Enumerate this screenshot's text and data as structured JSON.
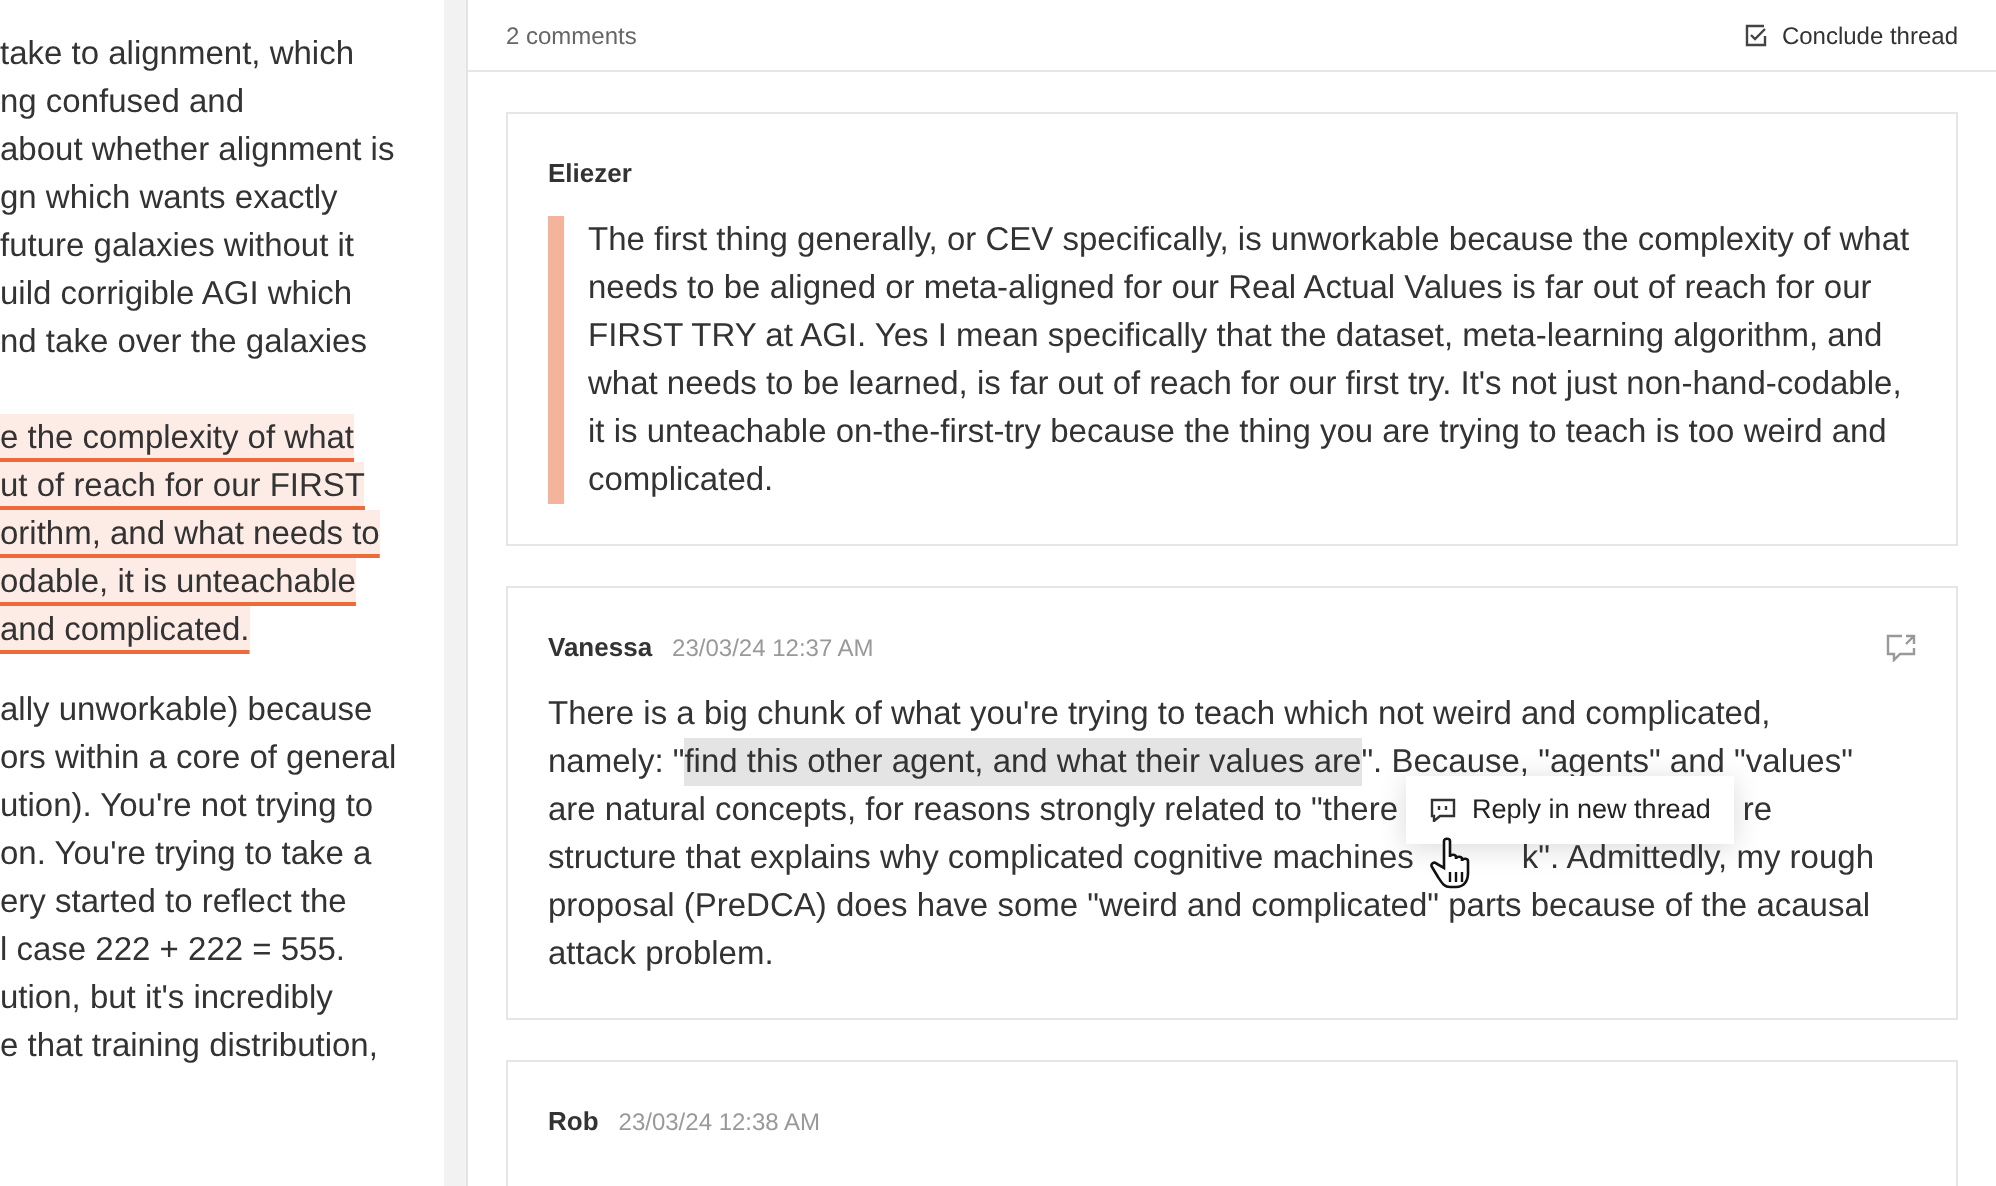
{
  "document": {
    "paragraphs": [
      {
        "highlighted": false,
        "lines": [
          "take to alignment, which",
          "ng confused and",
          "about whether alignment is",
          "gn which wants exactly",
          "future galaxies without it",
          "uild corrigible AGI which",
          "nd take over the galaxies"
        ]
      },
      {
        "highlighted": true,
        "lines": [
          "e the complexity of what",
          "ut of reach for our FIRST",
          "orithm, and what needs to",
          "odable, it is unteachable",
          "and complicated."
        ]
      },
      {
        "highlighted": false,
        "lines": [
          "ally unworkable) because",
          "ors within a core of general",
          "ution). You're not trying to",
          "on. You're trying to take a",
          "ery started to reflect the",
          "l case 222 + 222 = 555.",
          "ution, but it's incredibly",
          "e that training distribution,"
        ]
      }
    ]
  },
  "thread": {
    "count": "2 comments",
    "conclude_label": "Conclude thread"
  },
  "comments": [
    {
      "author": "Eliezer",
      "kind": "quote",
      "text": "The first thing generally, or CEV specifically, is unworkable because the complexity of what needs to be aligned or meta-aligned for our Real Actual Values is far out of reach for our FIRST TRY at AGI. Yes I mean specifically that the dataset, meta-learning algorithm, and what needs to be learned, is far out of reach for our first try. It's not just non-hand-codable, it is unteachable on-the-first-try because the thing you are trying to teach is too weird and complicated."
    },
    {
      "author": "Vanessa",
      "time": "23/03/24 12:37 AM",
      "kind": "lines",
      "lines": [
        [
          {
            "kind": "text",
            "text": "There is a big chunk of what you're trying to teach which not weird and complicated,"
          }
        ],
        [
          {
            "kind": "text",
            "text": "namely: \""
          },
          {
            "kind": "selection",
            "text": "find this other agent, and what their values are"
          },
          {
            "kind": "text",
            "text": "\". Because, \"agents\" and \"values\""
          }
        ],
        [
          {
            "kind": "text",
            "text": "are natural concepts, for reasons strongly related to \"there"
          },
          {
            "kind": "popup"
          },
          {
            "kind": "text",
            "text": "re"
          }
        ],
        [
          {
            "kind": "text",
            "text": "structure that explains why complicated cognitive machines"
          },
          {
            "kind": "cursor"
          },
          {
            "kind": "text",
            "text": "k\". Admittedly, my rough"
          }
        ],
        [
          {
            "kind": "text",
            "text": "proposal (PreDCA) does have some \"weird and complicated\" parts because of the acausal"
          }
        ],
        [
          {
            "kind": "text",
            "text": "attack problem."
          }
        ]
      ],
      "popup": {
        "label": "Reply in new thread"
      }
    },
    {
      "author": "Rob",
      "time": "23/03/24 12:38 AM",
      "kind": "header"
    }
  ]
}
